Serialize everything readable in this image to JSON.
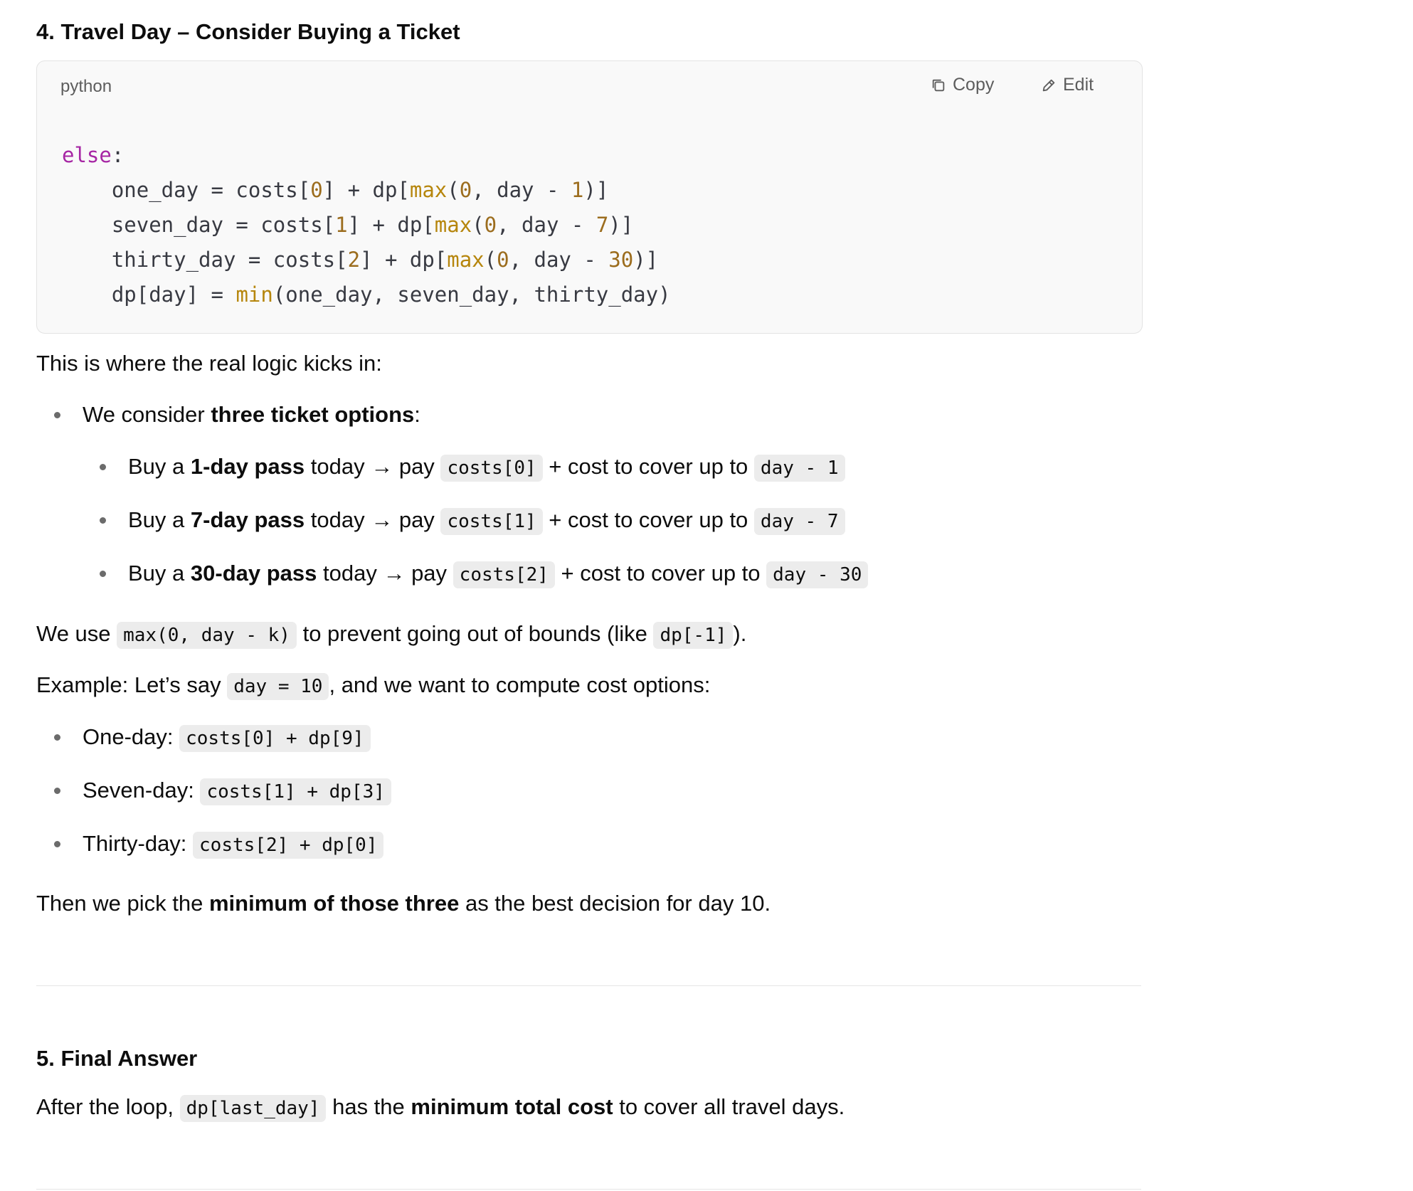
{
  "section4": {
    "heading": "4. Travel Day – Consider Buying a Ticket",
    "code_block": {
      "language": "python",
      "copy_label": "Copy",
      "edit_label": "Edit"
    },
    "intro": "This is where the real logic kicks in:",
    "consider": {
      "pre": "We consider ",
      "bold": "three ticket options",
      "post": ":"
    },
    "options": [
      {
        "pre": "Buy a ",
        "bold": "1-day pass",
        "mid": " today → pay ",
        "code1": "costs[0]",
        "mid2": " + cost to cover up to ",
        "code2": "day - 1"
      },
      {
        "pre": "Buy a ",
        "bold": "7-day pass",
        "mid": " today → pay ",
        "code1": "costs[1]",
        "mid2": " + cost to cover up to ",
        "code2": "day - 7"
      },
      {
        "pre": "Buy a ",
        "bold": "30-day pass",
        "mid": " today → pay ",
        "code1": "costs[2]",
        "mid2": " + cost to cover up to ",
        "code2": "day - 30"
      }
    ],
    "bounds": {
      "pre": "We use ",
      "code1": "max(0, day - k)",
      "mid": " to prevent going out of bounds (like ",
      "code2": "dp[-1]",
      "post": ")."
    },
    "example": {
      "pre": "Example: Let’s say ",
      "code": "day = 10",
      "post": ", and we want to compute cost options:"
    },
    "example_items": [
      {
        "label": "One-day: ",
        "code": "costs[0] + dp[9]"
      },
      {
        "label": "Seven-day: ",
        "code": "costs[1] + dp[3]"
      },
      {
        "label": "Thirty-day: ",
        "code": "costs[2] + dp[0]"
      }
    ],
    "conclusion": {
      "pre": "Then we pick the ",
      "bold": "minimum of those three",
      "post": " as the best decision for day 10."
    }
  },
  "section5": {
    "heading": "5. Final Answer",
    "text": {
      "pre": "After the loop, ",
      "code": "dp[last_day]",
      "mid": " has the ",
      "bold": "minimum total cost",
      "post": " to cover all travel days."
    }
  }
}
